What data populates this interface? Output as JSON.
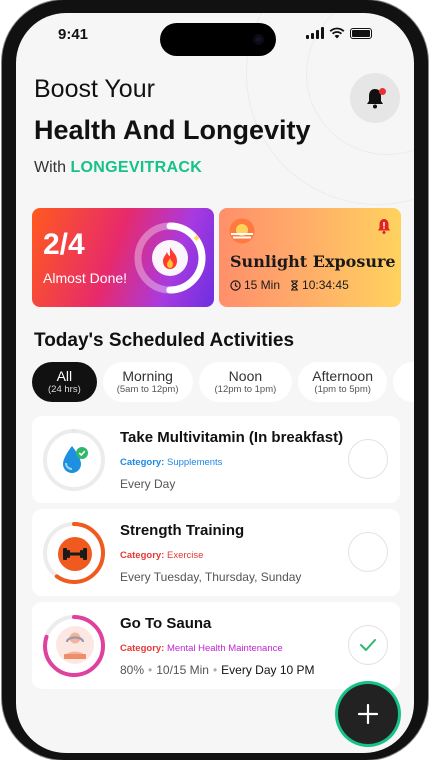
{
  "status": {
    "time": "9:41"
  },
  "header": {
    "line1": "Boost Your",
    "line2": "Health And Longevity",
    "with_prefix": "With",
    "brand": "LONGEVITRACK"
  },
  "progress_card": {
    "count": "2/4",
    "label": "Almost Done!",
    "completed": 2,
    "total": 4
  },
  "sunlight_card": {
    "title": "Sunlight Exposure",
    "duration": "15 Min",
    "time": "10:34:45"
  },
  "section_title": "Today's Scheduled Activities",
  "filters": [
    {
      "label": "All",
      "sub": "(24 hrs)",
      "active": true
    },
    {
      "label": "Morning",
      "sub": "(5am to 12pm)",
      "active": false
    },
    {
      "label": "Noon",
      "sub": "(12pm to 1pm)",
      "active": false
    },
    {
      "label": "Afternoon",
      "sub": "(1pm to 5pm)",
      "active": false
    }
  ],
  "activities": [
    {
      "name": "Take Multivitamin (In breakfast)",
      "category_label": "Category:",
      "category": "Supplements",
      "category_color": "#1e88e5",
      "frequency": "Every Day",
      "ring_color": "#e6e6e6",
      "progress": 0,
      "done": false
    },
    {
      "name": "Strength Training",
      "category_label": "Category:",
      "category": "Exercise",
      "category_color": "#e53935",
      "frequency": "Every Tuesday, Thursday, Sunday",
      "ring_color": "#f05a1e",
      "progress": 0.6,
      "done": false
    },
    {
      "name": "Go To Sauna",
      "category_label": "Category:",
      "category": "Mental Health Maintenance",
      "category_color": "#c026d3",
      "percent": "80%",
      "duration": "10/15 Min",
      "schedule": "Every Day 10 PM",
      "ring_color": "#e040a0",
      "progress": 0.8,
      "done": true
    }
  ]
}
